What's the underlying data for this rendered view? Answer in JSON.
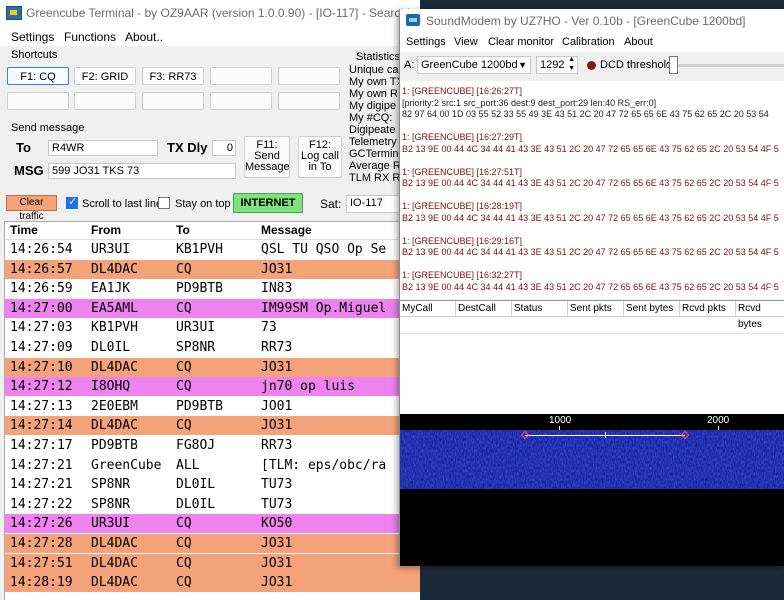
{
  "gc": {
    "title": "Greencube Terminal - by OZ9AAR (version 1.0.0.90) - [IO-117] - Searching ADIF file",
    "menu": [
      "Settings",
      "Functions",
      "About.."
    ],
    "shortcuts_label": "Shortcuts",
    "shortcuts": [
      "F1: CQ",
      "F2: GRID",
      "F3: RR73"
    ],
    "send_label": "Send message",
    "to_label": "To",
    "to_value": "R4WR",
    "txdly_label": "TX Dly",
    "txdly_value": "0",
    "f11_label": "F11: Send Message",
    "f12_label": "F12: Log call in To",
    "msg_label": "MSG",
    "msg_value": "599 JO31 TKS 73",
    "clear_traffic": "Clear traffic",
    "scroll_label": "Scroll to last line",
    "scroll_checked": true,
    "stay_on_top_label": "Stay on top",
    "stay_on_top_checked": false,
    "internet_label": "INTERNET",
    "sat_label": "Sat:",
    "sat_value": "IO-117",
    "stats_label": "Statistics",
    "stats": [
      "Unique ca",
      "My own TX",
      "My own R",
      "My digipe",
      "My #CQ:",
      "Digipeate",
      "Telemetry",
      "GCTermin",
      "Average R",
      "TLM RX R"
    ],
    "colors": {
      "orange": "#f4a27a",
      "pink": "#ee82ee",
      "white": "#ffffff",
      "clear": "#f4a27a",
      "internet": "#7ee37e"
    },
    "log_headers": [
      "Time",
      "From",
      "To",
      "Message"
    ],
    "log_rows": [
      {
        "time": "14:26:54",
        "from": "UR3UI",
        "to": "KB1PVH",
        "msg": "QSL TU QSO Op Se",
        "color": "white"
      },
      {
        "time": "14:26:57",
        "from": "DL4DAC",
        "to": "CQ",
        "msg": "JO31",
        "color": "orange"
      },
      {
        "time": "14:26:59",
        "from": "EA1JK",
        "to": "PD9BTB",
        "msg": "IN83",
        "color": "white"
      },
      {
        "time": "14:27:00",
        "from": "EA5AML",
        "to": "CQ",
        "msg": "IM99SM Op.Miguel",
        "color": "pink"
      },
      {
        "time": "14:27:03",
        "from": "KB1PVH",
        "to": "UR3UI",
        "msg": "73",
        "color": "white"
      },
      {
        "time": "14:27:09",
        "from": "DL0IL",
        "to": "SP8NR",
        "msg": "RR73",
        "color": "white"
      },
      {
        "time": "14:27:10",
        "from": "DL4DAC",
        "to": "CQ",
        "msg": "JO31",
        "color": "orange"
      },
      {
        "time": "14:27:12",
        "from": "I8OHQ",
        "to": "CQ",
        "msg": "jn70 op  luis",
        "color": "pink"
      },
      {
        "time": "14:27:13",
        "from": "2E0EBM",
        "to": "PD9BTB",
        "msg": "JO01",
        "color": "white"
      },
      {
        "time": "14:27:14",
        "from": "DL4DAC",
        "to": "CQ",
        "msg": "JO31",
        "color": "orange"
      },
      {
        "time": "14:27:17",
        "from": "PD9BTB",
        "to": "FG8OJ",
        "msg": "RR73",
        "color": "white"
      },
      {
        "time": "14:27:21",
        "from": "GreenCube",
        "to": "ALL",
        "msg": "[TLM: eps/obc/ra",
        "color": "white"
      },
      {
        "time": "14:27:21",
        "from": "SP8NR",
        "to": "DL0IL",
        "msg": "TU73",
        "color": "white"
      },
      {
        "time": "14:27:22",
        "from": "SP8NR",
        "to": "DL0IL",
        "msg": "TU73",
        "color": "white"
      },
      {
        "time": "14:27:26",
        "from": "UR3UI",
        "to": "CQ",
        "msg": "KO50",
        "color": "pink"
      },
      {
        "time": "14:27:28",
        "from": "DL4DAC",
        "to": "CQ",
        "msg": "JO31",
        "color": "orange"
      },
      {
        "time": "14:27:51",
        "from": "DL4DAC",
        "to": "CQ",
        "msg": "JO31",
        "color": "orange"
      },
      {
        "time": "14:28:19",
        "from": "DL4DAC",
        "to": "CQ",
        "msg": "JO31",
        "color": "orange"
      }
    ]
  },
  "sm": {
    "title": "SoundModem by UZ7HO - Ver 0.10b - [GreenCube 1200bd]",
    "menu": [
      "Settings",
      "View",
      "Clear monitor",
      "Calibration",
      "About"
    ],
    "channel_label": "A:",
    "modem_value": "GreenCube 1200bd",
    "freq_value": "1292",
    "dcd_label": "DCD threshold",
    "log_lines": [
      {
        "text": "1: [GREENCUBE] [16:26:27T]",
        "dark": false
      },
      {
        "text": "[priority:2 src:1 src_port:36 dest:9 dest_port:29 len:40 RS_err:0]",
        "dark": true
      },
      {
        "text": "82 97 64 00 1D 03 55 52 33 55 49 3E 43 51 2C 20 47 72 65 65 6E 43 75 62 65 2C 20 53 54",
        "dark": true
      },
      {
        "text": "",
        "dark": false
      },
      {
        "text": "1: [GREENCUBE] [16:27:29T]",
        "dark": false
      },
      {
        "text": "B2 13 9E 00 44 4C 34 44 41 43 3E 43 51 2C 20 47 72 65 65 6E 43 75 62 65 2C 20 53 54 4F 5",
        "dark": false
      },
      {
        "text": "",
        "dark": false
      },
      {
        "text": "1: [GREENCUBE] [16:27:51T]",
        "dark": false
      },
      {
        "text": "B2 13 9E 00 44 4C 34 44 41 43 3E 43 51 2C 20 47 72 65 65 6E 43 75 62 65 2C 20 53 54 4F 5",
        "dark": false
      },
      {
        "text": "",
        "dark": false
      },
      {
        "text": "1: [GREENCUBE] [16:28:19T]",
        "dark": false
      },
      {
        "text": "B2 13 9E 00 44 4C 34 44 41 43 3E 43 51 2C 20 47 72 65 65 6E 43 75 62 65 2C 20 53 54 4F 5",
        "dark": false
      },
      {
        "text": "",
        "dark": false
      },
      {
        "text": "1: [GREENCUBE] [16:29:16T]",
        "dark": false
      },
      {
        "text": "B2 13 9E 00 44 4C 34 44 41 43 3E 43 51 2C 20 47 72 65 65 6E 43 75 62 65 2C 20 53 54 4F 5",
        "dark": false
      },
      {
        "text": "",
        "dark": false
      },
      {
        "text": "1: [GREENCUBE] [16:32:27T]",
        "dark": false
      },
      {
        "text": "B2 13 9E 00 44 4C 34 44 41 43 3E 43 51 2C 20 47 72 65 65 6E 43 75 62 65 2C 20 53 54 4F 5",
        "dark": false
      }
    ],
    "table_headers": [
      "MyCall",
      "DestCall",
      "Status",
      "Sent pkts",
      "Sent bytes",
      "Rcvd pkts",
      "Rcvd bytes"
    ],
    "ruler_labels": [
      "1000",
      "2000"
    ]
  }
}
